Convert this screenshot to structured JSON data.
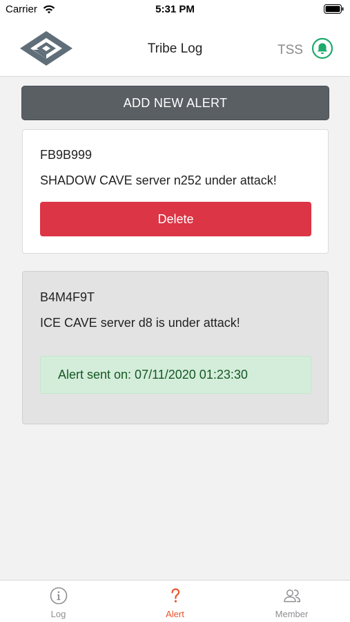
{
  "status_bar": {
    "carrier": "Carrier",
    "time": "5:31 PM",
    "wifi_icon": "wifi-icon",
    "battery_icon": "battery-icon"
  },
  "header": {
    "title": "Tribe Log",
    "user": "TSS",
    "logo_icon": "app-logo",
    "bell_icon": "bell-icon",
    "accent_color": "#1eaa6a"
  },
  "actions": {
    "add_alert_label": "ADD NEW ALERT"
  },
  "alerts": [
    {
      "code": "FB9B999",
      "message": "SHADOW CAVE server n252 under attack!",
      "delete_label": "Delete"
    },
    {
      "code": "B4M4F9T",
      "message": "ICE CAVE server d8 is under attack!",
      "sent_notice": "Alert sent on: 07/11/2020 01:23:30"
    }
  ],
  "tabs": [
    {
      "label": "Log",
      "icon": "info-icon",
      "active": false
    },
    {
      "label": "Alert",
      "icon": "question-icon",
      "active": true
    },
    {
      "label": "Member",
      "icon": "people-icon",
      "active": false
    }
  ],
  "colors": {
    "add_button": "#5a5f64",
    "delete_button": "#dc3545",
    "sent_notice_bg": "#d4edda",
    "sent_notice_text": "#155724",
    "active_tab": "#e8542e"
  }
}
